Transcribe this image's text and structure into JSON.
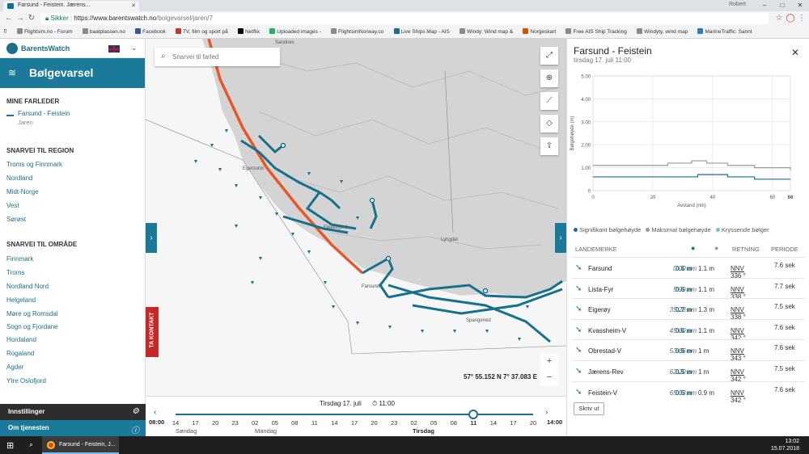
{
  "browser": {
    "tab_title": "Farsund - Feistein. Jærens...",
    "user": "Robert",
    "url_secure": "Sikker",
    "url_host": "https://www.barentswatch.no",
    "url_path": "/bolgevarsel/jaren/7",
    "bookmarks": [
      "Flightsim.no - Forum",
      "baatplassen.no",
      "Facebook",
      "TV, film og sport på",
      "Netflix",
      "Uploaded images -",
      "FlightsimNorway.co",
      "Live Ships Map - AIS",
      "Windy: Wind map &",
      "Norgeskart",
      "Free AIS Ship Tracking",
      "Windyty, wind map",
      "MarineTraffic: Sannt"
    ]
  },
  "sidebar": {
    "logo": "BarentsWatch",
    "app_title": "Bølgevarsel",
    "my_routes_heading": "MINE FARLEDER",
    "my_route_name": "Farsund - Feistein",
    "my_route_sub": "Jaren",
    "region_heading": "SNARVEI TIL REGION",
    "regions": [
      "Troms og Finnmark",
      "Nordland",
      "Midt-Norge",
      "Vest",
      "Sørøst"
    ],
    "area_heading": "SNARVEI TIL OMRÅDE",
    "areas": [
      "Finnmark",
      "Troms",
      "Nordland Nord",
      "Helgeland",
      "Møre og Romsdal",
      "Sogn og Fjordane",
      "Hordaland",
      "Rogaland",
      "Agder",
      "Ytre Oslofjord"
    ],
    "settings": "Innstillinger",
    "about": "Om tjenesten"
  },
  "map": {
    "search_placeholder": "Snarvei til farled",
    "coordinates": "57° 55.152 N 7° 37.083 E",
    "contact_label": "TA KONTAKT",
    "zoom_in": "+",
    "zoom_out": "−",
    "place_labels": [
      "Sandnes",
      "Egersund",
      "Flekkefjord",
      "Lyngdal",
      "Farsund",
      "Spangereid"
    ]
  },
  "timeline": {
    "date": "Tirsdag 17. juli",
    "time": "11:00",
    "start_time": "08:00",
    "end_time": "14:00",
    "hours": [
      "14",
      "17",
      "20",
      "23",
      "02",
      "05",
      "08",
      "11",
      "14",
      "17",
      "20",
      "23",
      "02",
      "05",
      "08",
      "11",
      "14",
      "17",
      "20"
    ],
    "selected_hour_index": 15,
    "days": [
      "Søndag",
      "Mandag",
      "Tirsdag"
    ]
  },
  "panel": {
    "title": "Farsund - Feistein",
    "subtitle": "tirsdag 17. juli 11:00",
    "legend": [
      "Signifikant bølgehøyde",
      "Maksimal bølgehøyde",
      "Kryssende bølger"
    ],
    "table_headers": {
      "landmark": "LANDEMERKE",
      "direction": "RETNING",
      "period": "PERIODE"
    },
    "rows": [
      {
        "name": "Farsund",
        "dist": "0.00 nm",
        "sig": "0.6 m",
        "max": "1.1 m",
        "dir": "336 °",
        "dir_code": "NNV",
        "period": "7.6 sek"
      },
      {
        "name": "Lista-Fyr",
        "dist": "5.99 nm",
        "sig": "0.6 m",
        "max": "1.1 m",
        "dir": "338 °",
        "dir_code": "NNV",
        "period": "7.7 sek"
      },
      {
        "name": "Eigerøy",
        "dist": "35.28 nm",
        "sig": "0.7 m",
        "max": "1.3 m",
        "dir": "338 °",
        "dir_code": "NNV",
        "period": "7.5 sek"
      },
      {
        "name": "Kvassheim-V",
        "dist": "45.60 nm",
        "sig": "0.6 m",
        "max": "1.1 m",
        "dir": "342 °",
        "dir_code": "NNV",
        "period": "7.6 sek"
      },
      {
        "name": "Obrestad-V",
        "dist": "53.66 nm",
        "sig": "0.5 m",
        "max": "1 m",
        "dir": "343 °",
        "dir_code": "NNV",
        "period": "7.6 sek"
      },
      {
        "name": "Jærens-Rev",
        "dist": "62.20 nm",
        "sig": "0.5 m",
        "max": "1 m",
        "dir": "342 °",
        "dir_code": "NNV",
        "period": "7.5 sek"
      },
      {
        "name": "Feistein-V",
        "dist": "65.53 nm",
        "sig": "0.5 m",
        "max": "0.9 m",
        "dir": "342 °",
        "dir_code": "NNV",
        "period": "7.6 sek"
      }
    ],
    "print": "Skriv ut"
  },
  "chart_data": {
    "type": "line",
    "xlabel": "Avstand (nm)",
    "ylabel": "Bølgehøyde (m)",
    "xlim": [
      0,
      66
    ],
    "ylim": [
      0,
      5
    ],
    "xticks": [
      "0",
      "20",
      "40",
      "60",
      "66"
    ],
    "yticks": [
      "0",
      "1.00",
      "2.00",
      "3.00",
      "4.00",
      "5.00"
    ],
    "grid": true,
    "series": [
      {
        "name": "Maksimal bølgehøyde",
        "color": "#999999",
        "x": [
          0,
          6,
          20,
          25,
          30,
          33,
          35,
          38,
          45,
          54,
          62,
          66
        ],
        "y": [
          1.1,
          1.1,
          1.1,
          1.2,
          1.2,
          1.3,
          1.3,
          1.2,
          1.1,
          1.0,
          1.0,
          0.9
        ]
      },
      {
        "name": "Signifikant bølgehøyde",
        "color": "#1b6f8a",
        "x": [
          0,
          6,
          20,
          30,
          35,
          38,
          45,
          54,
          62,
          66
        ],
        "y": [
          0.6,
          0.6,
          0.6,
          0.6,
          0.7,
          0.7,
          0.6,
          0.5,
          0.5,
          0.5
        ]
      },
      {
        "name": "Kryssende bølger",
        "color": "#6fc6c1",
        "x": [],
        "y": []
      }
    ]
  },
  "taskbar": {
    "app": "Farsund - Feistein, J...",
    "time": "13:02",
    "date": "15.07.2018"
  },
  "colors": {
    "primary": "#1b7a99",
    "route_orange": "#e8572a",
    "route_teal": "#15718c"
  }
}
